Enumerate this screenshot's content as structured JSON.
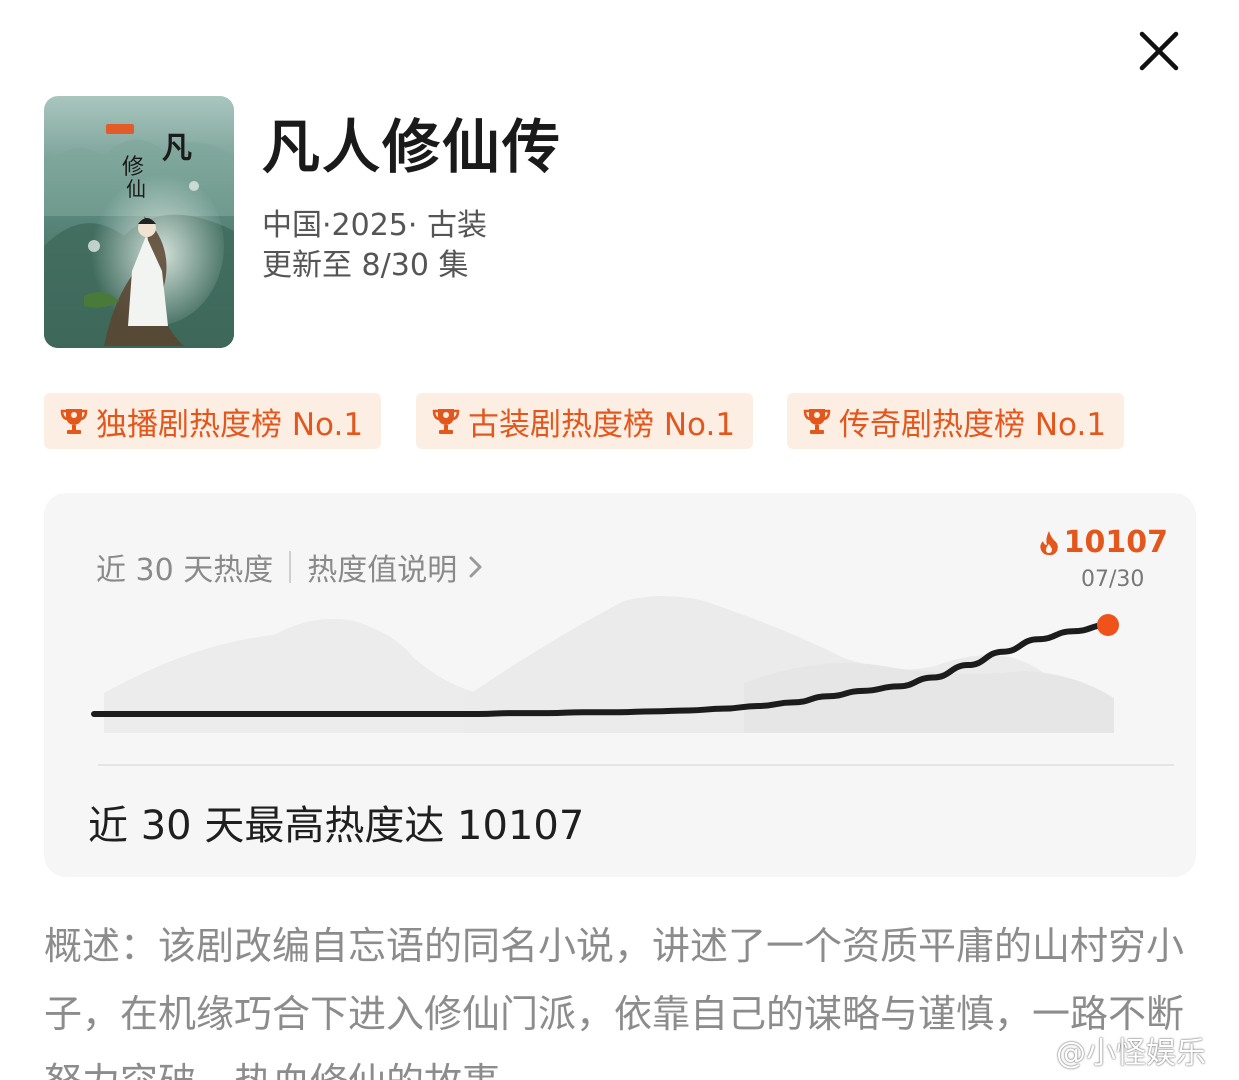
{
  "header": {
    "close_icon": "close-icon"
  },
  "show": {
    "title": "凡人修仙传",
    "meta": "中国·2025· 古装",
    "episodes": "更新至 8/30 集"
  },
  "badges": [
    {
      "icon": "trophy-icon",
      "label": "独播剧热度榜 No.1"
    },
    {
      "icon": "trophy-icon",
      "label": "古装剧热度榜 No.1"
    },
    {
      "icon": "trophy-icon",
      "label": "传奇剧热度榜 No.1"
    }
  ],
  "heat": {
    "label": "近 30 天热度",
    "help_label": "热度值说明",
    "peak_value": "10107",
    "peak_date": "07/30",
    "summary": "近 30 天最高热度达 10107",
    "accent_color": "#e4571c"
  },
  "chart_data": {
    "type": "line",
    "series": [
      {
        "values": [
          0.0,
          0.0,
          0.0,
          0.0,
          0.0,
          0.0,
          0.0,
          0.0,
          0.0,
          0.0,
          0.0,
          0.0,
          0.01,
          0.01,
          0.02,
          0.02,
          0.03,
          0.04,
          0.06,
          0.09,
          0.13,
          0.2,
          0.26,
          0.31,
          0.41,
          0.55,
          0.7,
          0.84,
          0.93,
          1.0
        ]
      }
    ],
    "peak_label": "10107",
    "peak_date": "07/30",
    "grid": false,
    "line_color": "#1c1c1c",
    "marker_color": "#f0521b"
  },
  "synopsis": {
    "text": "概述：该剧改编自忘语的同名小说，讲述了一个资质平庸的山村穷小子，在机缘巧合下进入修仙门派，依靠自己的谋略与谨慎，一路不断努力突破，热血修仙的故事"
  },
  "watermark": {
    "text": "@小怪娱乐",
    "icon": "weibo-icon"
  }
}
